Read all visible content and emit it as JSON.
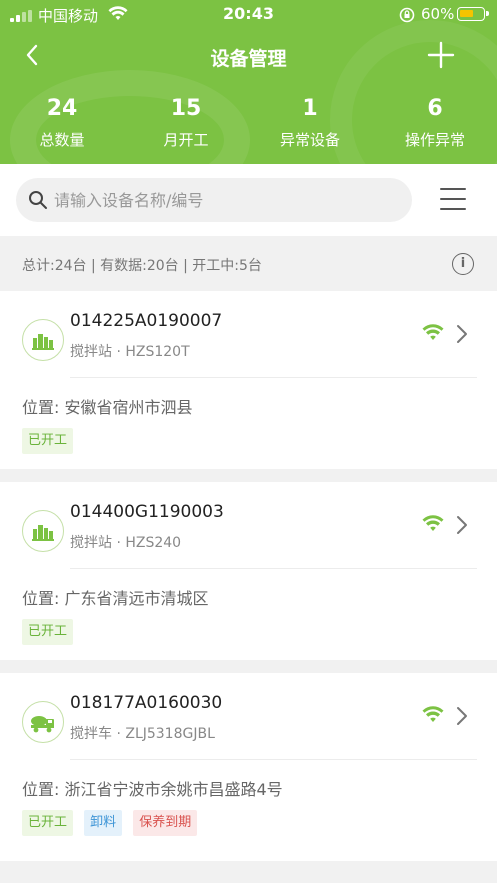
{
  "status_bar": {
    "carrier": "中国移动",
    "time": "20:43",
    "battery_percent": "60%",
    "battery_level": 0.6
  },
  "nav": {
    "title": "设备管理"
  },
  "stats": [
    {
      "value": "24",
      "label": "总数量"
    },
    {
      "value": "15",
      "label": "月开工"
    },
    {
      "value": "1",
      "label": "异常设备"
    },
    {
      "value": "6",
      "label": "操作异常"
    }
  ],
  "search": {
    "placeholder": "请输入设备名称/编号"
  },
  "summary": {
    "text": "总计:24台 | 有数据:20台 | 开工中:5台",
    "info_glyph": "i"
  },
  "devices": [
    {
      "code": "014225A0190007",
      "subtitle": "搅拌站 · HZS120T",
      "icon": "mixing-station-icon",
      "location": "位置: 安徽省宿州市泗县",
      "tags": [
        "已开工"
      ]
    },
    {
      "code": "014400G1190003",
      "subtitle": "搅拌站 · HZS240",
      "icon": "mixing-station-icon",
      "location": "位置: 广东省清远市清城区",
      "tags": [
        "已开工"
      ]
    },
    {
      "code": "018177A0160030",
      "subtitle": "搅拌车 · ZLJ5318GJBL",
      "icon": "mixer-truck-icon",
      "location": "位置: 浙江省宁波市余姚市昌盛路4号",
      "tags": [
        "已开工",
        "卸料",
        "保养到期"
      ]
    }
  ],
  "colors": {
    "brand_green": "#7cc243",
    "tag_green": "#6ab33a",
    "tag_blue": "#3d94d6",
    "tag_red": "#d9534f"
  }
}
